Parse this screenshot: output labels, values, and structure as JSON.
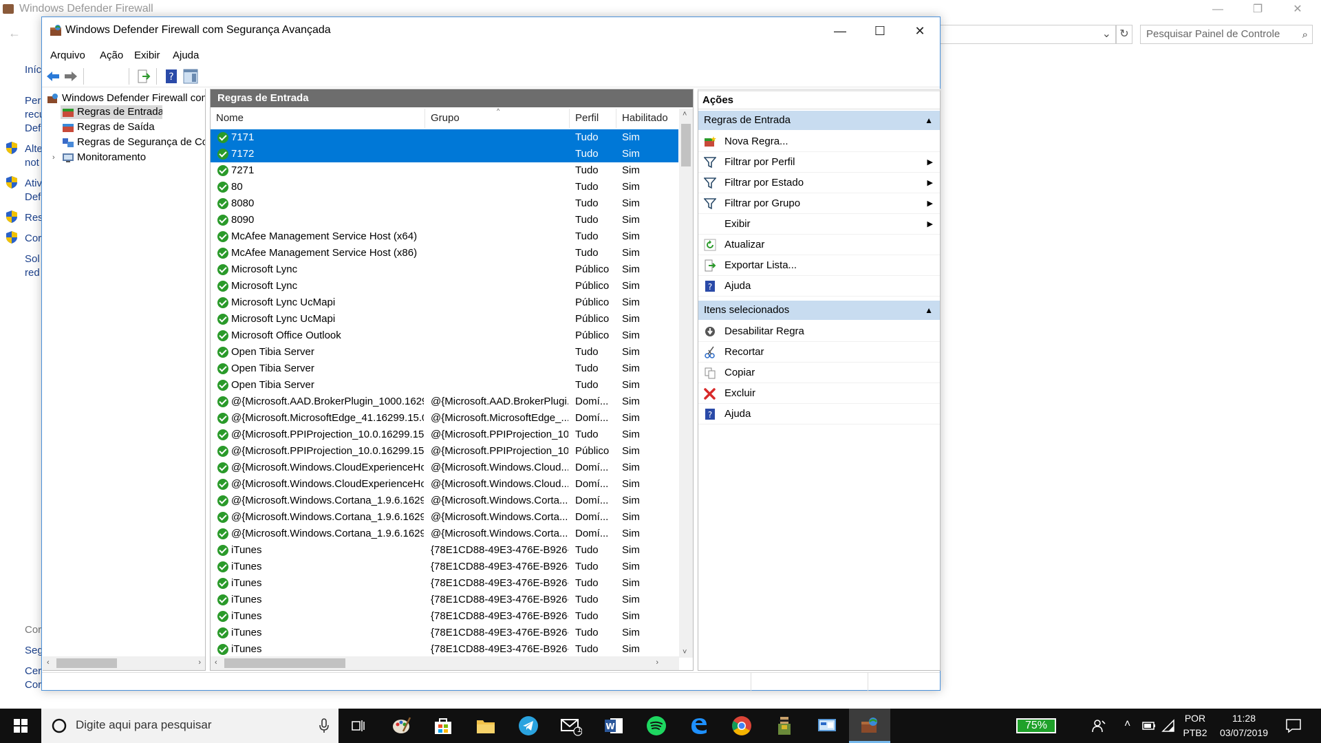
{
  "background_window": {
    "title": "Windows Defender Firewall",
    "search_placeholder": "Pesquisar Painel de Controle",
    "side_links": [
      "Iníc",
      "Perr",
      "recu",
      "Def",
      "Alte",
      "not",
      "Ativ",
      "Def",
      "Res",
      "Cor",
      "Sol",
      "red",
      "Cor",
      "Seg",
      "Cer",
      "Cor"
    ]
  },
  "window": {
    "title": "Windows Defender Firewall com Segurança Avançada",
    "minimize_glyph": "—",
    "maximize_glyph": "☐",
    "close_glyph": "✕"
  },
  "menu": [
    "Arquivo",
    "Ação",
    "Exibir",
    "Ajuda"
  ],
  "tree": {
    "root": "Windows Defender Firewall com",
    "items": [
      "Regras de Entrada",
      "Regras de Saída",
      "Regras de Segurança de Cor",
      "Monitoramento"
    ]
  },
  "rules_panel": {
    "header": "Regras de Entrada",
    "columns": [
      "Nome",
      "Grupo",
      "Perfil",
      "Habilitado"
    ],
    "rows": [
      {
        "name": "7171",
        "group": "",
        "profile": "Tudo",
        "enabled": "Sim",
        "selected": true
      },
      {
        "name": "7172",
        "group": "",
        "profile": "Tudo",
        "enabled": "Sim",
        "selected": true
      },
      {
        "name": "7271",
        "group": "",
        "profile": "Tudo",
        "enabled": "Sim"
      },
      {
        "name": "80",
        "group": "",
        "profile": "Tudo",
        "enabled": "Sim"
      },
      {
        "name": "8080",
        "group": "",
        "profile": "Tudo",
        "enabled": "Sim"
      },
      {
        "name": "8090",
        "group": "",
        "profile": "Tudo",
        "enabled": "Sim"
      },
      {
        "name": "McAfee Management Service Host (x64)",
        "group": "",
        "profile": "Tudo",
        "enabled": "Sim"
      },
      {
        "name": "McAfee Management Service Host (x86)",
        "group": "",
        "profile": "Tudo",
        "enabled": "Sim"
      },
      {
        "name": "Microsoft Lync",
        "group": "",
        "profile": "Público",
        "enabled": "Sim"
      },
      {
        "name": "Microsoft Lync",
        "group": "",
        "profile": "Público",
        "enabled": "Sim"
      },
      {
        "name": "Microsoft Lync UcMapi",
        "group": "",
        "profile": "Público",
        "enabled": "Sim"
      },
      {
        "name": "Microsoft Lync UcMapi",
        "group": "",
        "profile": "Público",
        "enabled": "Sim"
      },
      {
        "name": "Microsoft Office Outlook",
        "group": "",
        "profile": "Público",
        "enabled": "Sim"
      },
      {
        "name": "Open Tibia Server",
        "group": "",
        "profile": "Tudo",
        "enabled": "Sim"
      },
      {
        "name": "Open Tibia Server",
        "group": "",
        "profile": "Tudo",
        "enabled": "Sim"
      },
      {
        "name": "Open Tibia Server",
        "group": "",
        "profile": "Tudo",
        "enabled": "Sim"
      },
      {
        "name": "@{Microsoft.AAD.BrokerPlugin_1000.16299...",
        "group": "@{Microsoft.AAD.BrokerPlugi...",
        "profile": "Domí...",
        "enabled": "Sim"
      },
      {
        "name": "@{Microsoft.MicrosoftEdge_41.16299.15.0_...",
        "group": "@{Microsoft.MicrosoftEdge_...",
        "profile": "Domí...",
        "enabled": "Sim"
      },
      {
        "name": "@{Microsoft.PPIProjection_10.0.16299.15_n...",
        "group": "@{Microsoft.PPIProjection_10...",
        "profile": "Tudo",
        "enabled": "Sim"
      },
      {
        "name": "@{Microsoft.PPIProjection_10.0.16299.15_n...",
        "group": "@{Microsoft.PPIProjection_10...",
        "profile": "Público",
        "enabled": "Sim"
      },
      {
        "name": "@{Microsoft.Windows.CloudExperienceHo...",
        "group": "@{Microsoft.Windows.Cloud...",
        "profile": "Domí...",
        "enabled": "Sim"
      },
      {
        "name": "@{Microsoft.Windows.CloudExperienceHo...",
        "group": "@{Microsoft.Windows.Cloud...",
        "profile": "Domí...",
        "enabled": "Sim"
      },
      {
        "name": "@{Microsoft.Windows.Cortana_1.9.6.16299...",
        "group": "@{Microsoft.Windows.Corta...",
        "profile": "Domí...",
        "enabled": "Sim"
      },
      {
        "name": "@{Microsoft.Windows.Cortana_1.9.6.16299...",
        "group": "@{Microsoft.Windows.Corta...",
        "profile": "Domí...",
        "enabled": "Sim"
      },
      {
        "name": "@{Microsoft.Windows.Cortana_1.9.6.16299...",
        "group": "@{Microsoft.Windows.Corta...",
        "profile": "Domí...",
        "enabled": "Sim"
      },
      {
        "name": "iTunes",
        "group": "{78E1CD88-49E3-476E-B926-...",
        "profile": "Tudo",
        "enabled": "Sim"
      },
      {
        "name": "iTunes",
        "group": "{78E1CD88-49E3-476E-B926-...",
        "profile": "Tudo",
        "enabled": "Sim"
      },
      {
        "name": "iTunes",
        "group": "{78E1CD88-49E3-476E-B926-...",
        "profile": "Tudo",
        "enabled": "Sim"
      },
      {
        "name": "iTunes",
        "group": "{78E1CD88-49E3-476E-B926-...",
        "profile": "Tudo",
        "enabled": "Sim"
      },
      {
        "name": "iTunes",
        "group": "{78E1CD88-49E3-476E-B926-...",
        "profile": "Tudo",
        "enabled": "Sim"
      },
      {
        "name": "iTunes",
        "group": "{78E1CD88-49E3-476E-B926-...",
        "profile": "Tudo",
        "enabled": "Sim"
      },
      {
        "name": "iTunes",
        "group": "{78E1CD88-49E3-476E-B926-...",
        "profile": "Tudo",
        "enabled": "Sim"
      }
    ]
  },
  "actions": {
    "title": "Ações",
    "section1": {
      "label": "Regras de Entrada",
      "items": [
        {
          "label": "Nova Regra...",
          "icon": "new-rule-icon",
          "submenu": false
        },
        {
          "label": "Filtrar por Perfil",
          "icon": "filter-icon",
          "submenu": true
        },
        {
          "label": "Filtrar por Estado",
          "icon": "filter-icon",
          "submenu": true
        },
        {
          "label": "Filtrar por Grupo",
          "icon": "filter-icon",
          "submenu": true
        },
        {
          "label": "Exibir",
          "icon": "",
          "submenu": true
        },
        {
          "label": "Atualizar",
          "icon": "refresh-icon",
          "submenu": false
        },
        {
          "label": "Exportar Lista...",
          "icon": "export-icon",
          "submenu": false
        },
        {
          "label": "Ajuda",
          "icon": "help-icon",
          "submenu": false
        }
      ]
    },
    "section2": {
      "label": "Itens selecionados",
      "items": [
        {
          "label": "Desabilitar Regra",
          "icon": "disable-icon"
        },
        {
          "label": "Recortar",
          "icon": "cut-icon"
        },
        {
          "label": "Copiar",
          "icon": "copy-icon"
        },
        {
          "label": "Excluir",
          "icon": "delete-icon"
        },
        {
          "label": "Ajuda",
          "icon": "help-icon"
        }
      ]
    }
  },
  "taskbar": {
    "search_placeholder": "Digite aqui para pesquisar",
    "battery": "75%",
    "language": "POR",
    "layout": "PTB2",
    "time": "11:28",
    "date": "03/07/2019",
    "mail_badge": "1"
  },
  "colors": {
    "selection": "#0078d7",
    "panel_header": "#6d6d6d",
    "action_section": "#c8dcf0",
    "rule_enabled": "#2a9a2a"
  }
}
